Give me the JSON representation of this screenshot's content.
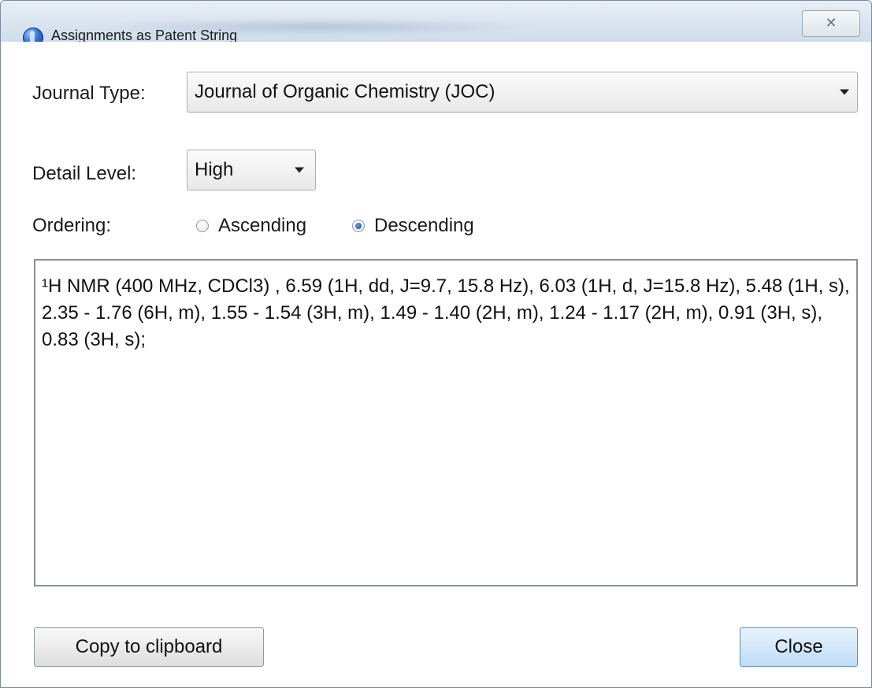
{
  "window": {
    "title": "Assignments as Patent String",
    "close_glyph": "✕"
  },
  "form": {
    "journal_type_label": "Journal Type:",
    "journal_type_value": "Journal of Organic Chemistry (JOC)",
    "detail_level_label": "Detail Level:",
    "detail_level_value": "High",
    "ordering_label": "Ordering:",
    "ordering_options": [
      {
        "label": "Ascending",
        "checked": false
      },
      {
        "label": "Descending",
        "checked": true
      }
    ]
  },
  "output_text": "¹H NMR (400 MHz, CDCl3) , 6.59 (1H, dd, J=9.7, 15.8 Hz), 6.03 (1H, d, J=15.8 Hz), 5.48 (1H, s), 2.35 - 1.76 (6H, m), 1.55 - 1.54 (3H, m), 1.49 - 1.40 (2H, m), 1.24 - 1.17 (2H, m), 0.91 (3H, s), 0.83 (3H, s);",
  "buttons": {
    "copy_label": "Copy to clipboard",
    "close_label": "Close"
  },
  "icons": {
    "app": "app-globe-icon",
    "title_close": "close-icon",
    "dropdown": "chevron-down-icon"
  }
}
